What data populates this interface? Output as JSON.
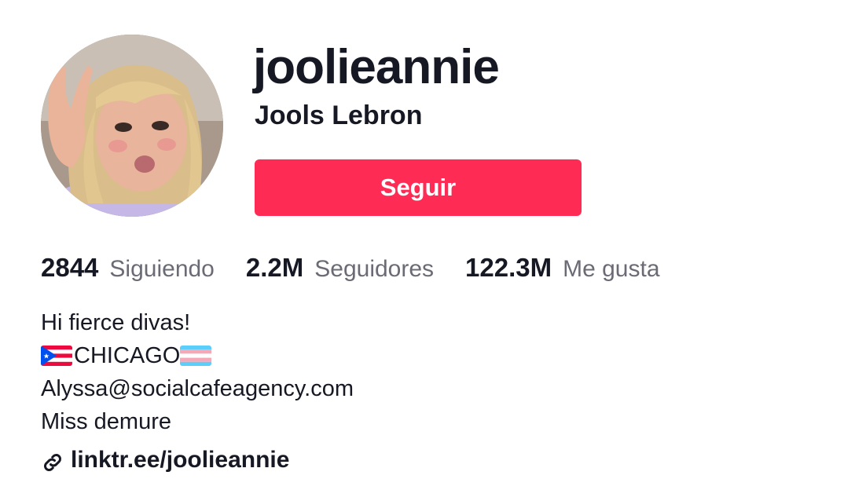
{
  "profile": {
    "username": "joolieannie",
    "display_name": "Jools Lebron",
    "follow_label": "Seguir"
  },
  "stats": {
    "following": {
      "value": "2844",
      "label": "Siguiendo"
    },
    "followers": {
      "value": "2.2M",
      "label": "Seguidores"
    },
    "likes": {
      "value": "122.3M",
      "label": "Me gusta"
    }
  },
  "bio": {
    "line1": "Hi fierce divas!",
    "line2": "CHICAGO",
    "line3": "Alyssa@socialcafeagency.com",
    "line4": "Miss demure",
    "flag_left_icon": "puerto-rico-flag-icon",
    "flag_right_icon": "transgender-flag-icon"
  },
  "link": {
    "text": "linktr.ee/joolieannie",
    "icon": "link-icon"
  },
  "colors": {
    "accent": "#fe2c55",
    "text_primary": "#161823",
    "text_secondary": "#6a6b74"
  }
}
